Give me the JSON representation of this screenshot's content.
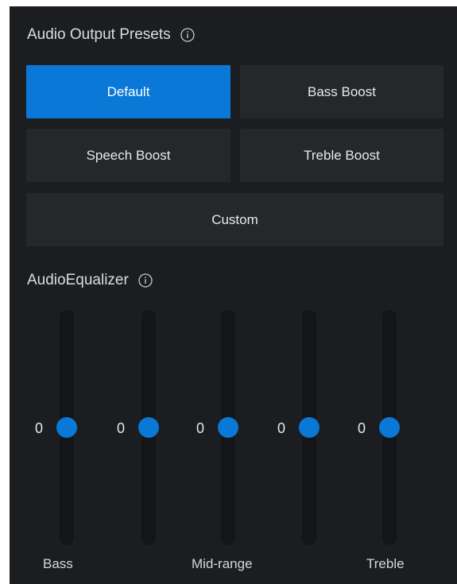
{
  "presets_section": {
    "title": "Audio Output Presets",
    "info_icon": "info-circle-icon",
    "buttons": [
      {
        "label": "Default",
        "active": true
      },
      {
        "label": "Bass Boost",
        "active": false
      },
      {
        "label": "Speech Boost",
        "active": false
      },
      {
        "label": "Treble Boost",
        "active": false
      },
      {
        "label": "Custom",
        "active": false
      }
    ]
  },
  "equalizer": {
    "title": "AudioEqualizer",
    "info_icon": "info-circle-icon",
    "bands": [
      {
        "value": "0",
        "level": 0
      },
      {
        "value": "0",
        "level": 0
      },
      {
        "value": "0",
        "level": 0
      },
      {
        "value": "0",
        "level": 0
      },
      {
        "value": "0",
        "level": 0
      }
    ],
    "labels": {
      "bass": "Bass",
      "mid": "Mid-range",
      "treble": "Treble"
    }
  },
  "colors": {
    "panel_background": "#1c1d20",
    "button_background": "#26272b",
    "accent": "#0a78d7",
    "slider_track": "#141518"
  }
}
